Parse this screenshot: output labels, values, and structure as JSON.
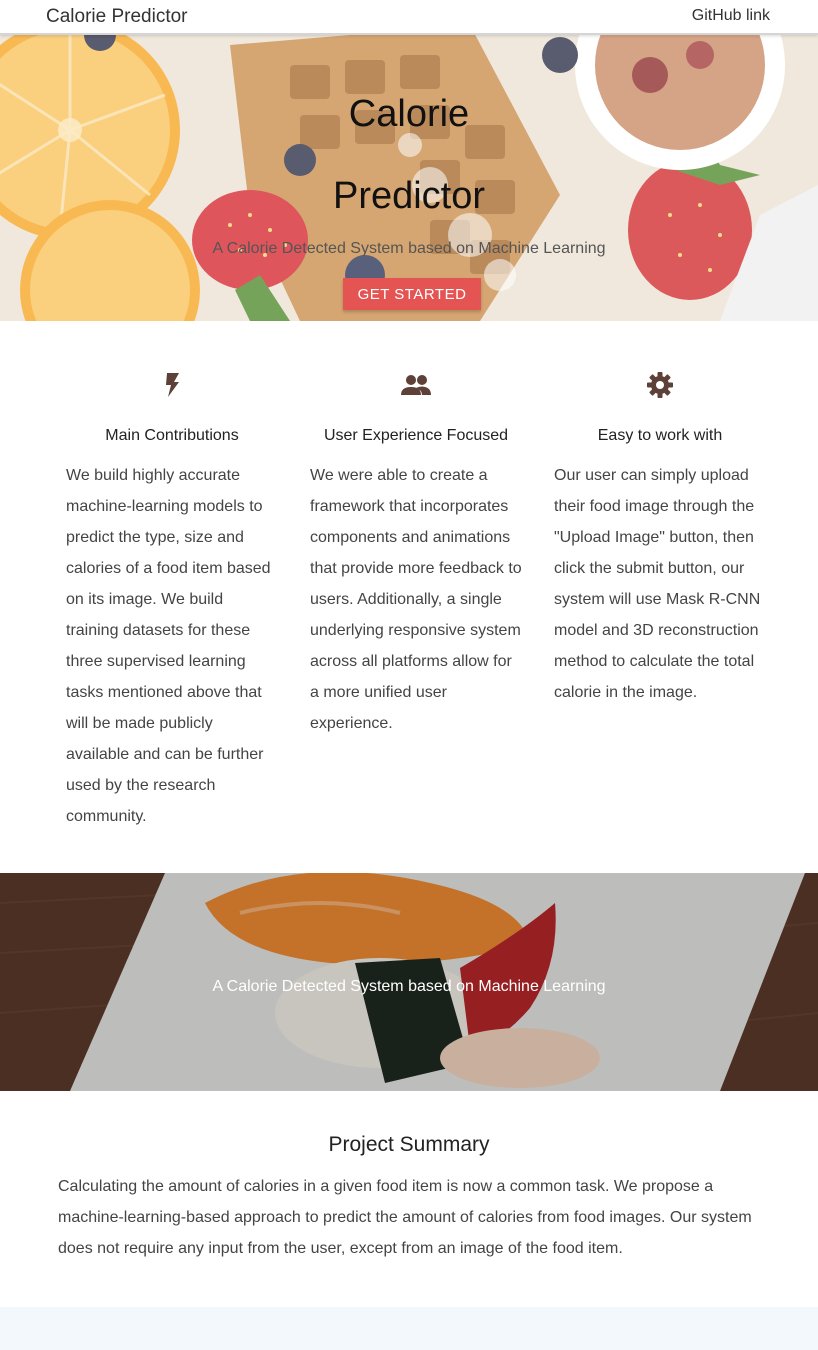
{
  "navbar": {
    "brand": "Calorie Predictor",
    "github_link": "GitHub link"
  },
  "hero": {
    "title_line1": "Calorie",
    "title_line2": "Predictor",
    "subtitle": "A Calorie Detected System based on Machine Learning",
    "cta_label": "GET STARTED"
  },
  "features": [
    {
      "icon": "flash-icon",
      "title": "Main Contributions",
      "text": "We build highly accurate machine-learning models to predict the type, size and calories of a food item based on its image. We build training datasets for these three supervised learning tasks mentioned above that will be made publicly available and can be further used by the research community."
    },
    {
      "icon": "group-icon",
      "title": "User Experience Focused",
      "text": "We were able to create a framework that incorporates components and animations that provide more feedback to users. Additionally, a single underlying responsive system across all platforms allow for a more unified user experience."
    },
    {
      "icon": "settings-icon",
      "title": "Easy to work with",
      "text": "Our user can simply upload their food image through the \"Upload Image\" button, then click the submit button, our system will use Mask R-CNN model and 3D reconstruction method to calculate the total calorie in the image."
    }
  ],
  "parallax2": {
    "text": "A Calorie Detected System based on Machine Learning"
  },
  "summary": {
    "title": "Project Summary",
    "text": "Calculating the amount of calories in a given food item is now a common task. We propose a machine-learning-based approach to predict the amount of calories from food images. Our system does not require any input from the user, except from an image of the food item."
  },
  "colors": {
    "accent": "#e35452",
    "icon": "#5d4037",
    "text": "#444444"
  }
}
